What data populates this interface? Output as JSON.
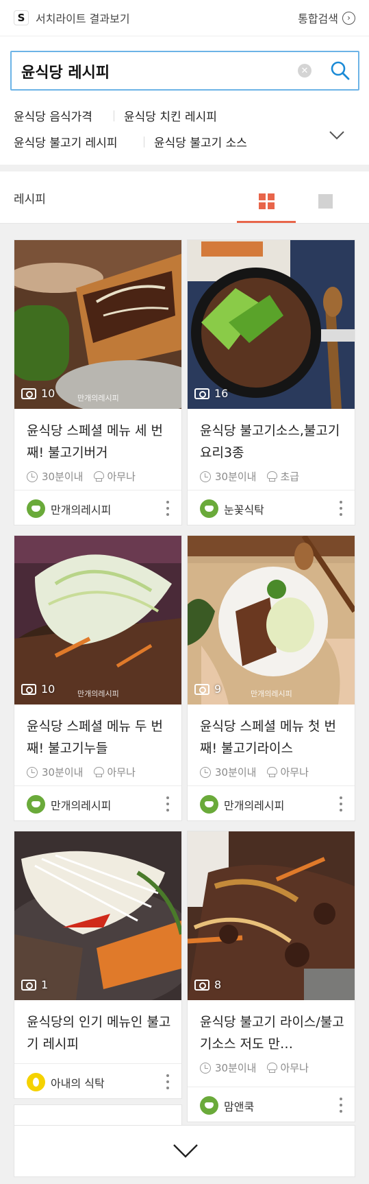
{
  "topbar": {
    "logo": "S",
    "title": "서치라이트 결과보기",
    "total_search": "통합검색"
  },
  "search": {
    "query": "윤식당 레시피",
    "suggestions": [
      "윤식당 음식가격",
      "윤식당 치킨 레시피",
      "윤식당 불고기 레시피",
      "윤식당 불고기 소스"
    ]
  },
  "section": {
    "label": "레시피",
    "view_modes": [
      "grid-icon",
      "single-icon"
    ],
    "accent_color": "#e8654a"
  },
  "cards": [
    {
      "count": "10",
      "watermark": "만개의레시피",
      "title": "윤식당 스페셜 메뉴 세 번째! 불고기버거",
      "time": "30분이내",
      "level": "아무나",
      "author": "만개의레시피",
      "avatar": "green"
    },
    {
      "count": "16",
      "watermark": "",
      "title": "윤식당 불고기소스,불고기요리3종",
      "time": "30분이내",
      "level": "초급",
      "author": "눈꽃식탁",
      "avatar": "green"
    },
    {
      "count": "10",
      "watermark": "만개의레시피",
      "title": "윤식당 스페셜 메뉴 두 번째! 불고기누들",
      "time": "30분이내",
      "level": "아무나",
      "author": "만개의레시피",
      "avatar": "green"
    },
    {
      "count": "9",
      "watermark": "만개의레시피",
      "title": "윤식당 스페셜 메뉴 첫 번째! 불고기라이스",
      "time": "30분이내",
      "level": "아무나",
      "author": "만개의레시피",
      "avatar": "green"
    },
    {
      "count": "1",
      "watermark": "",
      "title": "윤식당의 인기 메뉴인 불고기 레시피",
      "time": "",
      "level": "",
      "author": "아내의 식탁",
      "avatar": "yellow"
    },
    {
      "count": "8",
      "watermark": "",
      "title": "윤식당 불고기 라이스/불고기소스 저도 만…",
      "time": "30분이내",
      "level": "아무나",
      "author": "맘앤쿡",
      "avatar": "green"
    }
  ]
}
